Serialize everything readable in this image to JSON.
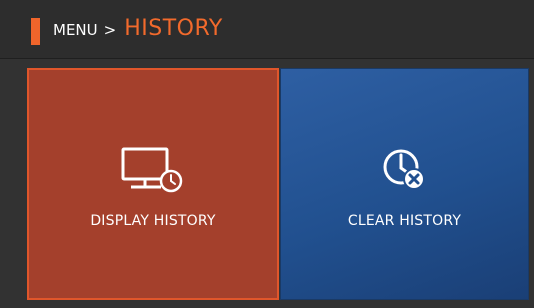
{
  "header": {
    "menu_label": "MENU",
    "separator": ">",
    "current_page": "HISTORY",
    "accent_color": "#f0652b"
  },
  "tiles": [
    {
      "label": "DISPLAY HISTORY",
      "icon": "monitor-clock-icon",
      "color": "#a4402c",
      "selected": true
    },
    {
      "label": "CLEAR HISTORY",
      "icon": "clock-clear-icon",
      "color": "#21508f",
      "selected": false
    }
  ]
}
